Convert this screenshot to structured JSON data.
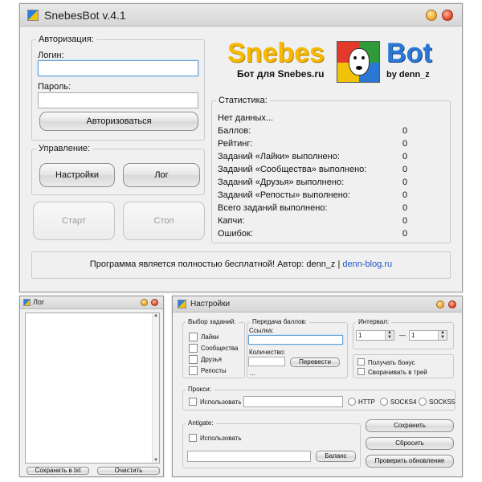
{
  "main": {
    "title": "SnebesBot v.4.1",
    "auth": {
      "legend": "Авторизация:",
      "login_label": "Логин:",
      "login_value": "",
      "password_label": "Пароль:",
      "password_value": "",
      "login_button": "Авторизоваться"
    },
    "control": {
      "legend": "Управление:",
      "settings_button": "Настройки",
      "log_button": "Лог",
      "start_button": "Старт",
      "stop_button": "Стоп"
    },
    "logo": {
      "left": "Snebes",
      "right": "Bot",
      "subtitle": "Бот для Snebes.ru",
      "by": "by denn_z"
    },
    "stats": {
      "legend": "Статистика:",
      "status": "Нет данных...",
      "rows": [
        {
          "label": "Баллов:",
          "value": "0"
        },
        {
          "label": "Рейтинг:",
          "value": "0"
        },
        {
          "label": "Заданий «Лайки» выполнено:",
          "value": "0"
        },
        {
          "label": "Заданий «Сообщества» выполнено:",
          "value": "0"
        },
        {
          "label": "Заданий «Друзья» выполнено:",
          "value": "0"
        },
        {
          "label": "Заданий «Репосты» выполнено:",
          "value": "0"
        },
        {
          "label": "Всего заданий выполнено:",
          "value": "0"
        },
        {
          "label": "Капчи:",
          "value": "0"
        },
        {
          "label": "Ошибок:",
          "value": "0"
        }
      ]
    },
    "footer": {
      "text": "Программа является полностью бесплатной! Автор: denn_z |",
      "link": "denn-blog.ru"
    }
  },
  "log_window": {
    "title": "Лог",
    "save_button": "Сохранить в txt",
    "clear_button": "Очистить"
  },
  "settings": {
    "title": "Настройки",
    "tasks": {
      "legend": "Выбор заданий:",
      "items": [
        "Лайки",
        "Сообщества",
        "Друзья",
        "Репосты"
      ]
    },
    "transfer": {
      "legend": "Передача баллов:",
      "link_label": "Ссылка:",
      "link_value": "",
      "amount_label": "Количество:",
      "amount_value": "",
      "ellipsis": "...",
      "transfer_button": "Перевести"
    },
    "interval": {
      "legend": "Интервал:",
      "from": "1",
      "dash": "—",
      "to": "1"
    },
    "options": {
      "bonus": "Получать бонус",
      "tray": "Сворачивать в трей"
    },
    "proxy": {
      "legend": "Прокси:",
      "use_label": "Использовать",
      "value": "",
      "types": [
        "HTTP",
        "SOCKS4",
        "SOCKS5"
      ]
    },
    "antigate": {
      "legend": "Antigate:",
      "use_label": "Использовать",
      "key_value": "",
      "balance_button": "Баланс"
    },
    "save_button": "Сохранить",
    "reset_button": "Сбросить",
    "update_button": "Проверить обновление"
  },
  "colors": {
    "logo_left": "#f6b800",
    "logo_right": "#2a78d4",
    "link": "#1a55c4",
    "focus": "#5ea0d8"
  }
}
